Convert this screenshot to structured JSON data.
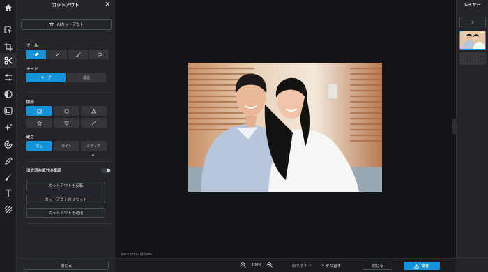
{
  "panel": {
    "title": "カットアウト",
    "ai_button": "AIカットアウト",
    "tool_label": "ツール",
    "mode_label": "モード",
    "mode_options": [
      "キープ",
      "消去"
    ],
    "shape_label": "図形",
    "hardness_label": "硬さ",
    "hardness_options": [
      "なし",
      "ライト",
      "ミディア"
    ],
    "check_label": "消去済み部分の確認",
    "invert_button": "カットアウトを反転",
    "reset_button": "カットアウトのリセット",
    "apply_button": "カットアウトを適用",
    "close_button": "閉じる"
  },
  "canvas": {
    "size_label": "640 x 427 px @ 100%"
  },
  "layers": {
    "title": "レイヤー",
    "add": "+",
    "more": "•••"
  },
  "bottom": {
    "zoom": "100%",
    "undo": "取り消す",
    "redo": "やり直す",
    "close": "閉じる",
    "save": "保存"
  },
  "colors": {
    "accent": "#1593d8",
    "panel_bg": "#23252a",
    "canvas_bg": "#131417"
  },
  "icons": {
    "rail": [
      "home-icon",
      "select-arrow-icon",
      "crop-icon",
      "cutout-scissors-icon",
      "adjust-sliders-icon",
      "filter-icon",
      "frame-icon",
      "sparkle-icon",
      "retouch-icon",
      "draw-pen-icon",
      "brush-icon",
      "text-icon",
      "texture-icon"
    ],
    "tools": [
      "shape-cut-icon",
      "magic-wand-icon",
      "brush-icon",
      "lasso-icon"
    ],
    "shapes": [
      "rectangle-icon",
      "circle-icon",
      "triangle-icon",
      "star-icon",
      "heart-icon",
      "line-icon"
    ]
  }
}
